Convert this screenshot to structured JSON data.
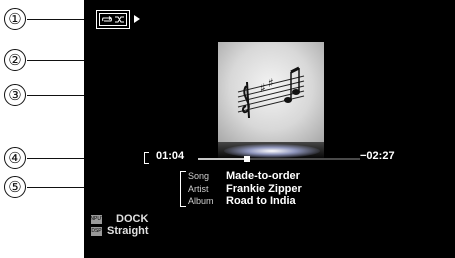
{
  "callouts": [
    "①",
    "②",
    "③",
    "④",
    "⑤"
  ],
  "status": {
    "repeat_icon": "repeat-icon",
    "shuffle_icon": "shuffle-icon",
    "play_icon": "play-icon"
  },
  "album_art": {
    "icon": "music-staff-icon"
  },
  "playback": {
    "elapsed": "01:04",
    "remaining": "−02:27",
    "progress": 0.3
  },
  "metadata": [
    {
      "key": "Song",
      "value": "Made-to-order"
    },
    {
      "key": "Artist",
      "value": "Frankie Zipper"
    },
    {
      "key": "Album",
      "value": "Road to India"
    }
  ],
  "source": {
    "input_badge": "INPUT",
    "input": "DOCK",
    "dsp_badge": "DSP",
    "dsp": "Straight"
  }
}
